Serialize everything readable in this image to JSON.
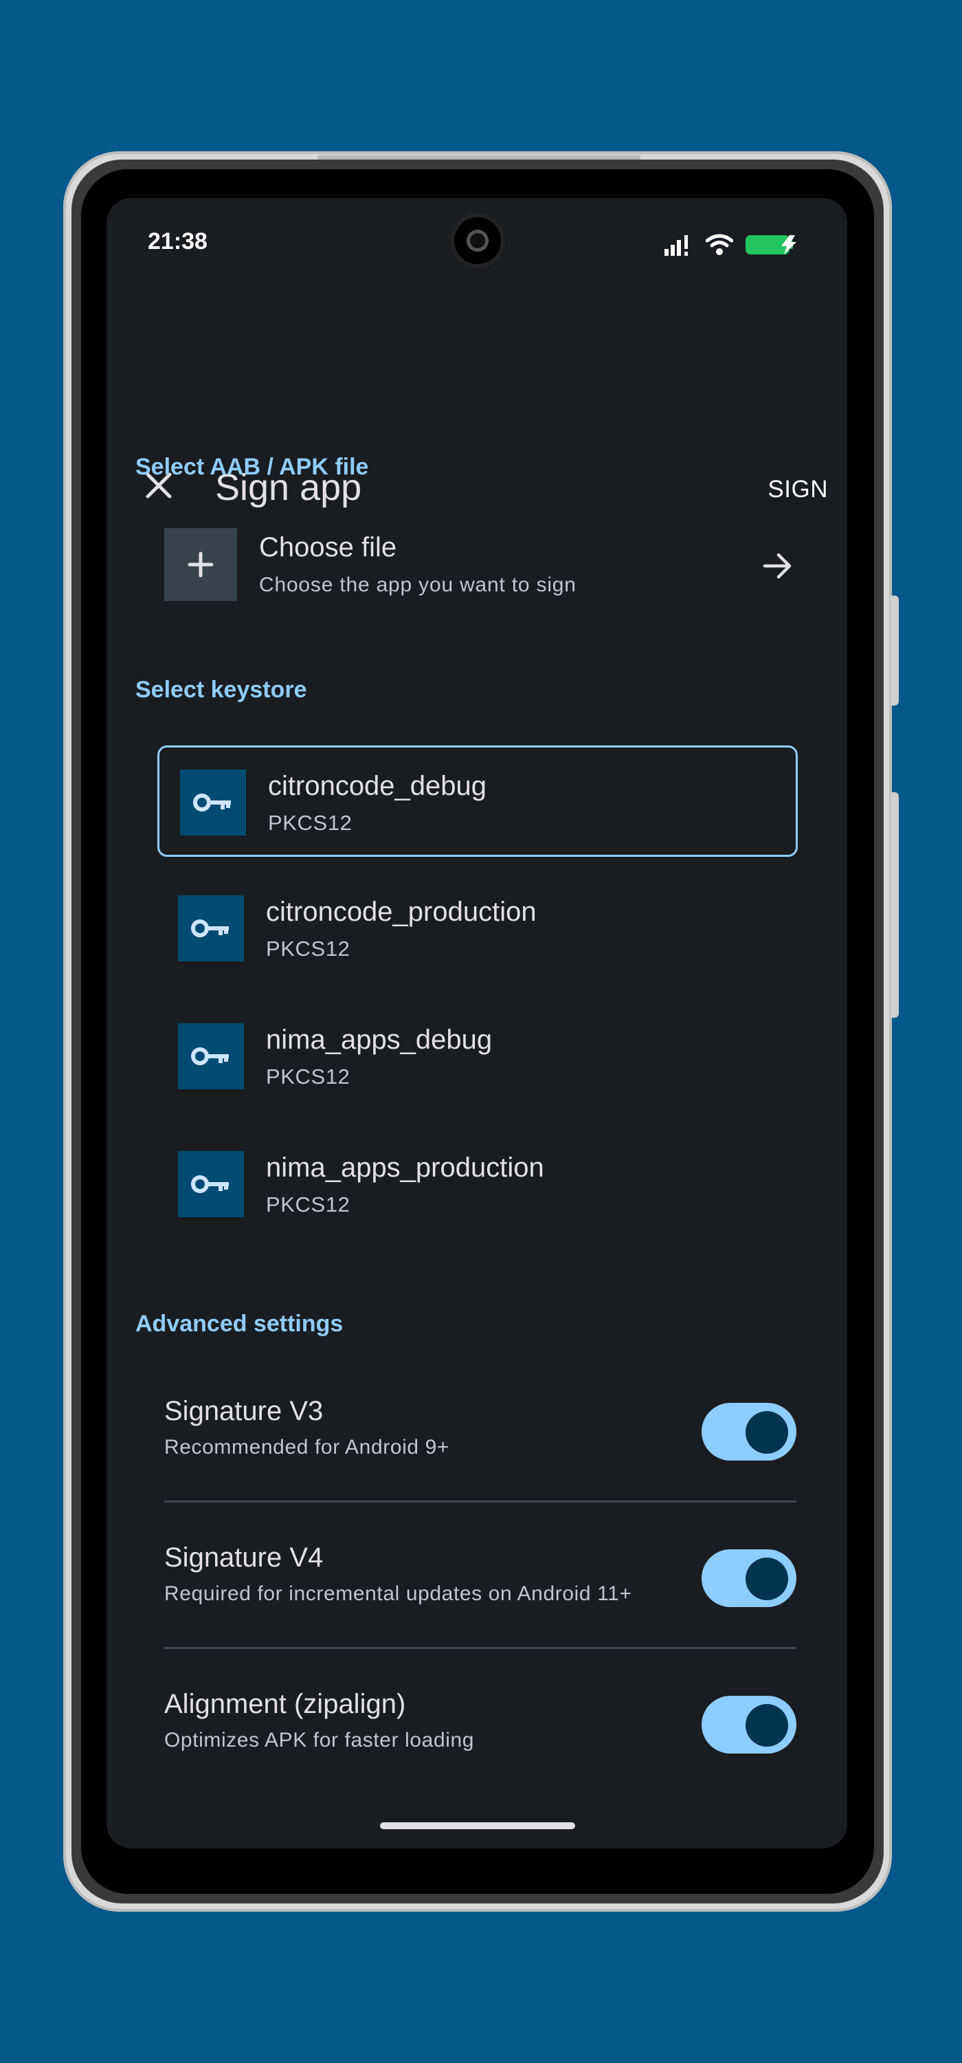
{
  "status_bar": {
    "time": "21:38"
  },
  "app_bar": {
    "close_icon": "close-icon",
    "title": "Sign app",
    "action_label": "SIGN"
  },
  "file_section": {
    "header": "Select AAB / APK file",
    "choose_title": "Choose file",
    "choose_subtitle": "Choose the app you want to sign"
  },
  "keystore_section": {
    "header": "Select keystore",
    "items": [
      {
        "name": "citroncode_debug",
        "type": "PKCS12",
        "selected": true
      },
      {
        "name": "citroncode_production",
        "type": "PKCS12",
        "selected": false
      },
      {
        "name": "nima_apps_debug",
        "type": "PKCS12",
        "selected": false
      },
      {
        "name": "nima_apps_production",
        "type": "PKCS12",
        "selected": false
      }
    ]
  },
  "advanced_section": {
    "header": "Advanced settings",
    "settings": [
      {
        "title": "Signature V3",
        "subtitle": "Recommended for Android 9+",
        "enabled": true
      },
      {
        "title": "Signature V4",
        "subtitle": "Required for incremental updates on Android 11+",
        "enabled": true
      },
      {
        "title": "Alignment (zipalign)",
        "subtitle": "Optimizes APK for faster loading",
        "enabled": true
      }
    ]
  },
  "colors": {
    "background": "#04588a",
    "screen": "#191c20",
    "accent": "#8ecdff",
    "toggle_knob": "#00344f",
    "icon_box": "#004b71"
  }
}
